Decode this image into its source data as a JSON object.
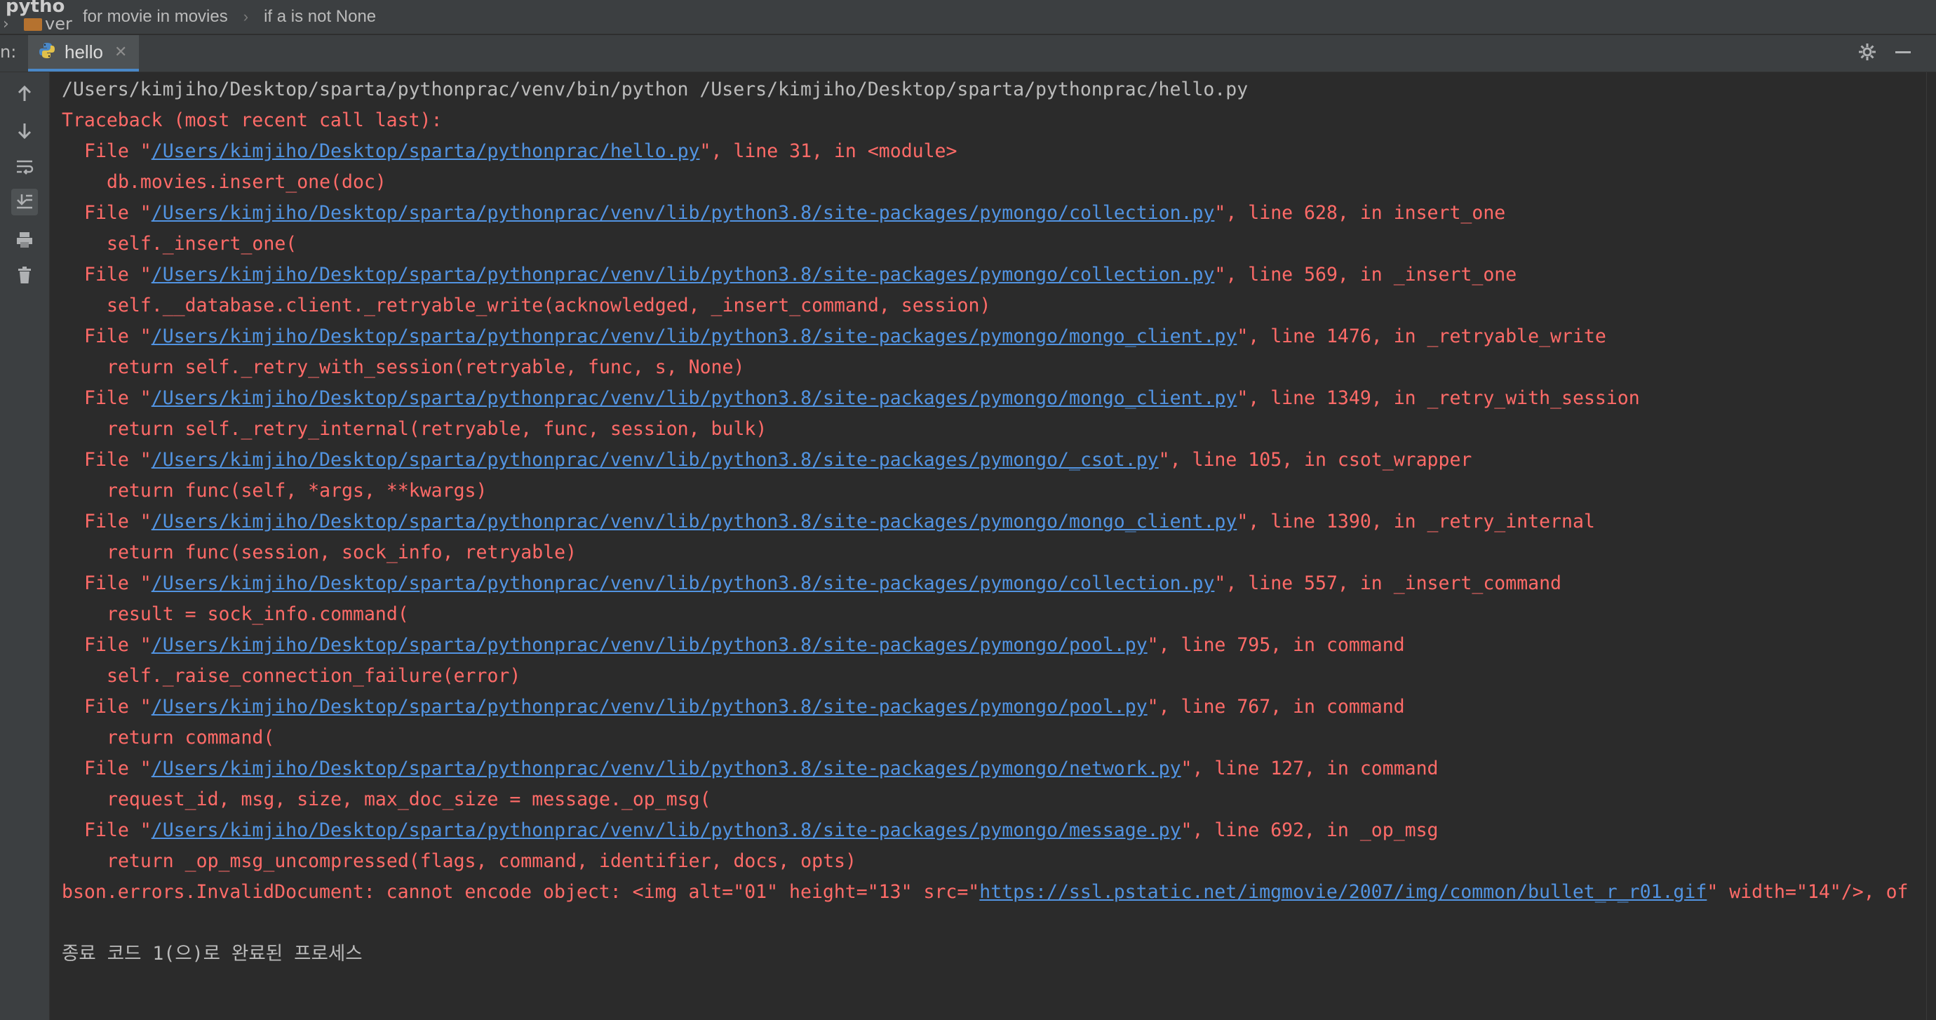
{
  "top": {
    "project_label": "pytho",
    "tree_item": "ver",
    "breadcrumb": [
      "for movie in movies",
      "if a is not None"
    ]
  },
  "run": {
    "panel_label": "n:",
    "tab_label": "hello"
  },
  "console": {
    "command": "/Users/kimjiho/Desktop/sparta/pythonprac/venv/bin/python /Users/kimjiho/Desktop/sparta/pythonprac/hello.py",
    "traceback_header": "Traceback (most recent call last):",
    "frames": [
      {
        "file": "/Users/kimjiho/Desktop/sparta/pythonprac/hello.py",
        "loc": ", line 31, in <module>",
        "code": "db.movies.insert_one(doc)"
      },
      {
        "file": "/Users/kimjiho/Desktop/sparta/pythonprac/venv/lib/python3.8/site-packages/pymongo/collection.py",
        "loc": ", line 628, in insert_one",
        "code": "self._insert_one("
      },
      {
        "file": "/Users/kimjiho/Desktop/sparta/pythonprac/venv/lib/python3.8/site-packages/pymongo/collection.py",
        "loc": ", line 569, in _insert_one",
        "code": "self.__database.client._retryable_write(acknowledged, _insert_command, session)"
      },
      {
        "file": "/Users/kimjiho/Desktop/sparta/pythonprac/venv/lib/python3.8/site-packages/pymongo/mongo_client.py",
        "loc": ", line 1476, in _retryable_write",
        "code": "return self._retry_with_session(retryable, func, s, None)"
      },
      {
        "file": "/Users/kimjiho/Desktop/sparta/pythonprac/venv/lib/python3.8/site-packages/pymongo/mongo_client.py",
        "loc": ", line 1349, in _retry_with_session",
        "code": "return self._retry_internal(retryable, func, session, bulk)"
      },
      {
        "file": "/Users/kimjiho/Desktop/sparta/pythonprac/venv/lib/python3.8/site-packages/pymongo/_csot.py",
        "loc": ", line 105, in csot_wrapper",
        "code": "return func(self, *args, **kwargs)"
      },
      {
        "file": "/Users/kimjiho/Desktop/sparta/pythonprac/venv/lib/python3.8/site-packages/pymongo/mongo_client.py",
        "loc": ", line 1390, in _retry_internal",
        "code": "return func(session, sock_info, retryable)"
      },
      {
        "file": "/Users/kimjiho/Desktop/sparta/pythonprac/venv/lib/python3.8/site-packages/pymongo/collection.py",
        "loc": ", line 557, in _insert_command",
        "code": "result = sock_info.command("
      },
      {
        "file": "/Users/kimjiho/Desktop/sparta/pythonprac/venv/lib/python3.8/site-packages/pymongo/pool.py",
        "loc": ", line 795, in command",
        "code": "self._raise_connection_failure(error)"
      },
      {
        "file": "/Users/kimjiho/Desktop/sparta/pythonprac/venv/lib/python3.8/site-packages/pymongo/pool.py",
        "loc": ", line 767, in command",
        "code": "return command("
      },
      {
        "file": "/Users/kimjiho/Desktop/sparta/pythonprac/venv/lib/python3.8/site-packages/pymongo/network.py",
        "loc": ", line 127, in command",
        "code": "request_id, msg, size, max_doc_size = message._op_msg("
      },
      {
        "file": "/Users/kimjiho/Desktop/sparta/pythonprac/venv/lib/python3.8/site-packages/pymongo/message.py",
        "loc": ", line 692, in _op_msg",
        "code": "return _op_msg_uncompressed(flags, command, identifier, docs, opts)"
      }
    ],
    "error_prefix": "bson.errors.InvalidDocument: cannot encode object: <img alt=\"01\" height=\"13\" src=\"",
    "error_url": "https://ssl.pstatic.net/imgmovie/2007/img/common/bullet_r_r01.gif",
    "error_suffix": "\" width=\"14\"/>, of",
    "exit_message": "종료 코드 1(으)로 완료된 프로세스"
  },
  "colors": {
    "background": "#2b2b2b",
    "error_text": "#ff6b68",
    "link": "#5294e2",
    "plain_text": "#bbbbbb"
  },
  "icons": [
    "up-arrow-icon",
    "down-arrow-icon",
    "soft-wrap-icon",
    "scroll-to-end-icon",
    "print-icon",
    "trash-icon",
    "python-icon",
    "gear-icon",
    "minimize-icon"
  ]
}
